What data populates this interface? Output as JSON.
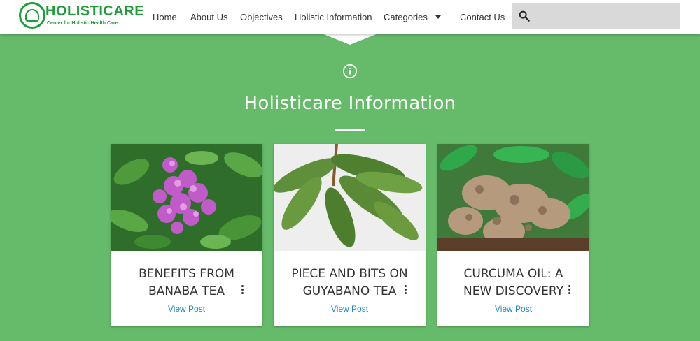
{
  "header": {
    "logo": {
      "title": "HOLISTICARE",
      "subtitle": "Center for Holistic Health Care"
    },
    "nav": [
      {
        "label": "Home"
      },
      {
        "label": "About Us"
      },
      {
        "label": "Objectives"
      },
      {
        "label": "Holistic Information"
      },
      {
        "label": "Categories"
      },
      {
        "label": "Contact Us"
      }
    ],
    "search": {
      "icon": "search-icon",
      "placeholder": ""
    }
  },
  "section": {
    "icon": "info-icon",
    "title": "Holisticare Information"
  },
  "cards": [
    {
      "title": "BENEFITS FROM BANABA TEA",
      "link": "View Post",
      "image": "banaba-flowers-image"
    },
    {
      "title": "PIECE AND BITS ON GUYABANO TEA",
      "link": "View Post",
      "image": "guyabano-leaves-image"
    },
    {
      "title": "CURCUMA OIL: A NEW DISCOVERY",
      "link": "View Post",
      "image": "curcuma-roots-image"
    }
  ],
  "colors": {
    "background": "#66bb6a",
    "brand": "#1f9d3a",
    "link": "#1e88c8",
    "header": "#ffffff",
    "search_bg": "#d9d9d9"
  }
}
